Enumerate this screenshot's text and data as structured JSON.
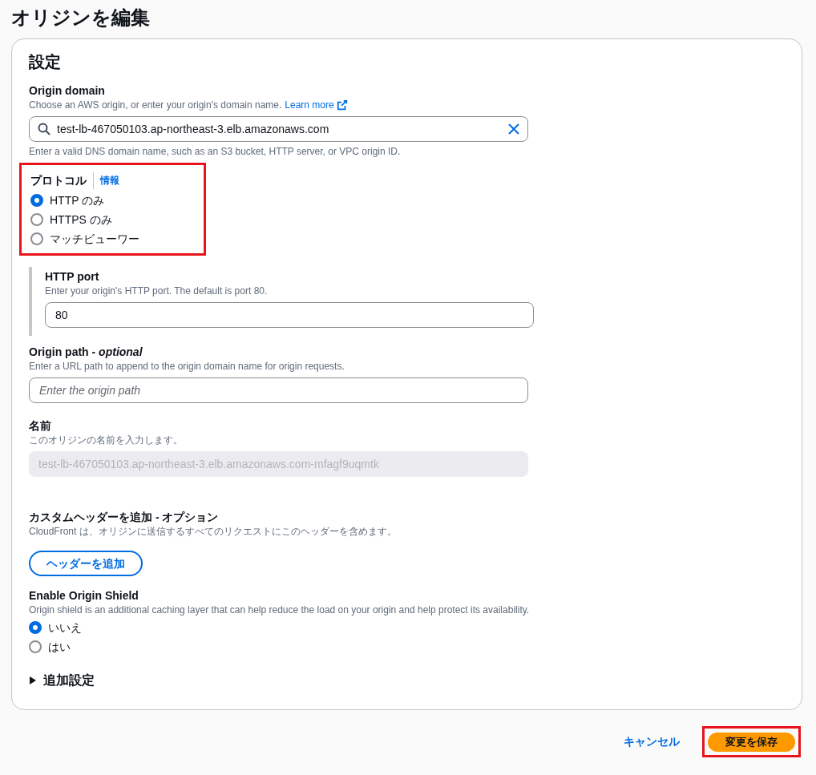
{
  "page_title": "オリジンを編集",
  "section": {
    "title": "設定",
    "origin_domain": {
      "label": "Origin domain",
      "description": "Choose an AWS origin, or enter your origin's domain name.",
      "learn_more": "Learn more",
      "value": "test-lb-467050103.ap-northeast-3.elb.amazonaws.com",
      "hint": "Enter a valid DNS domain name, such as an S3 bucket, HTTP server, or VPC origin ID."
    },
    "protocol": {
      "label": "プロトコル",
      "info": "情報",
      "highlighted": true,
      "options": [
        {
          "label": "HTTP のみ",
          "selected": true
        },
        {
          "label": "HTTPS のみ",
          "selected": false
        },
        {
          "label": "マッチビューワー",
          "selected": false
        }
      ]
    },
    "http_port": {
      "label": "HTTP port",
      "description": "Enter your origin's HTTP port. The default is port 80.",
      "value": "80"
    },
    "origin_path": {
      "label": "Origin path - *optional*",
      "description": "Enter a URL path to append to the origin domain name for origin requests.",
      "placeholder": "Enter the origin path"
    },
    "name": {
      "label": "名前",
      "description": "このオリジンの名前を入力します。",
      "value": "test-lb-467050103.ap-northeast-3.elb.amazonaws.com-mfagf9uqmtk",
      "disabled": true
    },
    "custom_headers": {
      "label": "カスタムヘッダーを追加 - オプション",
      "description": "CloudFront は、オリジンに送信するすべてのリクエストにこのヘッダーを含めます。",
      "button": "ヘッダーを追加"
    },
    "origin_shield": {
      "label": "Enable Origin Shield",
      "description": "Origin shield is an additional caching layer that can help reduce the load on your origin and help protect its availability.",
      "options": [
        {
          "label": "いいえ",
          "selected": true
        },
        {
          "label": "はい",
          "selected": false
        }
      ]
    },
    "additional_settings": {
      "label": "追加設定",
      "expanded": false
    }
  },
  "footer": {
    "cancel": "キャンセル",
    "save": {
      "label": "変更を保存",
      "highlighted": true
    }
  }
}
